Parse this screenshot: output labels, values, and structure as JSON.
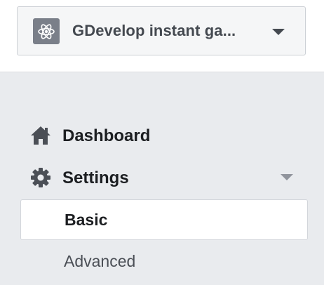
{
  "app_selector": {
    "name": "GDevelop instant ga...",
    "icon": "atom-icon"
  },
  "nav": {
    "items": [
      {
        "label": "Dashboard",
        "icon": "home-icon"
      },
      {
        "label": "Settings",
        "icon": "gear-icon",
        "expanded": true
      }
    ],
    "settings_sub": [
      {
        "label": "Basic",
        "active": true
      },
      {
        "label": "Advanced",
        "active": false
      }
    ]
  },
  "colors": {
    "nav_background": "#e9ebee",
    "text": "#1c1e21",
    "icon": "#4b4f56"
  }
}
